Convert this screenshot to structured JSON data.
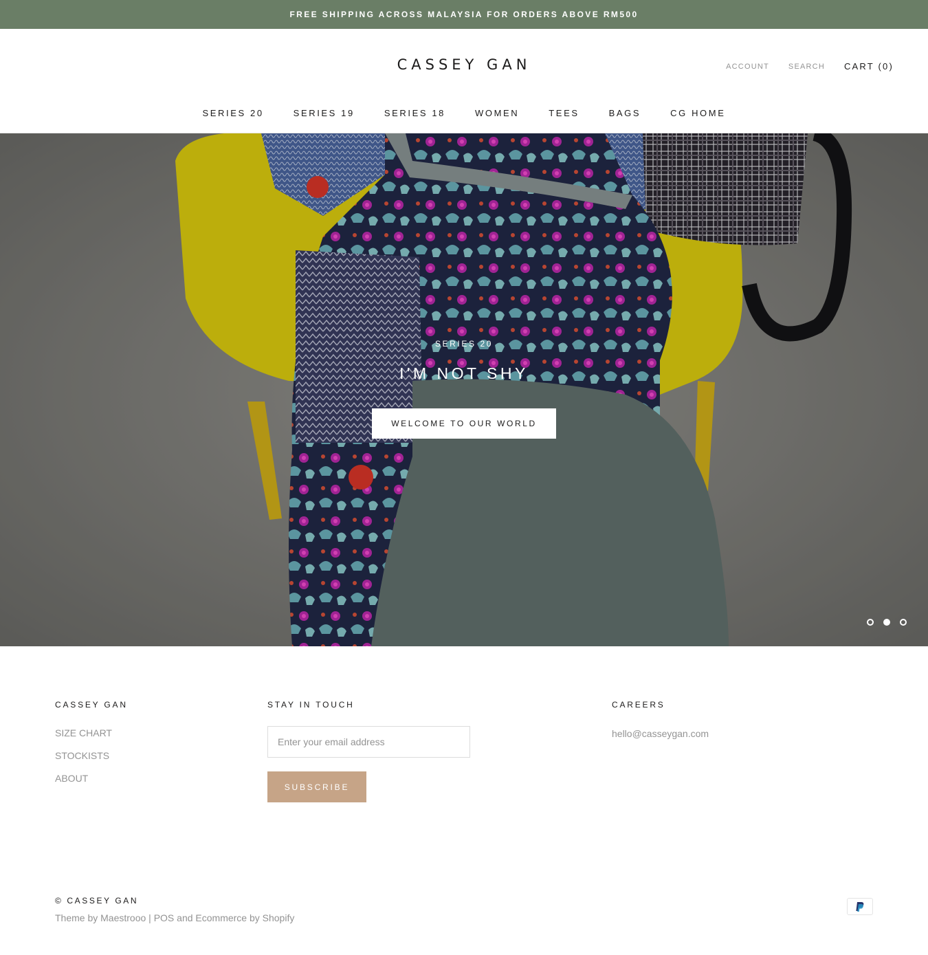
{
  "announcement": {
    "text": "FREE SHIPPING ACROSS MALAYSIA FOR ORDERS ABOVE RM500"
  },
  "header": {
    "logo": "CASSEY GAN",
    "account": "ACCOUNT",
    "search": "SEARCH",
    "cart": "CART (0)"
  },
  "nav": {
    "items": [
      {
        "label": "SERIES 20"
      },
      {
        "label": "SERIES 19"
      },
      {
        "label": "SERIES 18"
      },
      {
        "label": "WOMEN"
      },
      {
        "label": "TEES"
      },
      {
        "label": "BAGS"
      },
      {
        "label": "CG HOME"
      }
    ]
  },
  "hero": {
    "subtitle": "SERIES 20",
    "title": "I'M NOT SHY",
    "button": "WELCOME TO OUR WORLD",
    "slides": 3,
    "active_slide": 2
  },
  "footer": {
    "col1": {
      "title": "CASSEY GAN",
      "links": [
        "SIZE CHART",
        "STOCKISTS",
        "ABOUT"
      ]
    },
    "col2": {
      "title": "STAY IN TOUCH",
      "email_placeholder": "Enter your email address",
      "subscribe": "SUBSCRIBE"
    },
    "col3": {
      "title": "CAREERS",
      "email": "hello@casseygan.com"
    },
    "copyright": "© CASSEY GAN",
    "credits": "Theme by Maestrooo | POS and Ecommerce by Shopify",
    "payment_icons": [
      "paypal-icon"
    ]
  },
  "colors": {
    "announcement_bg": "#6a7e66",
    "subscribe_bg": "#c6a487",
    "text_dark": "#1c1b1b",
    "text_muted": "#939393"
  }
}
